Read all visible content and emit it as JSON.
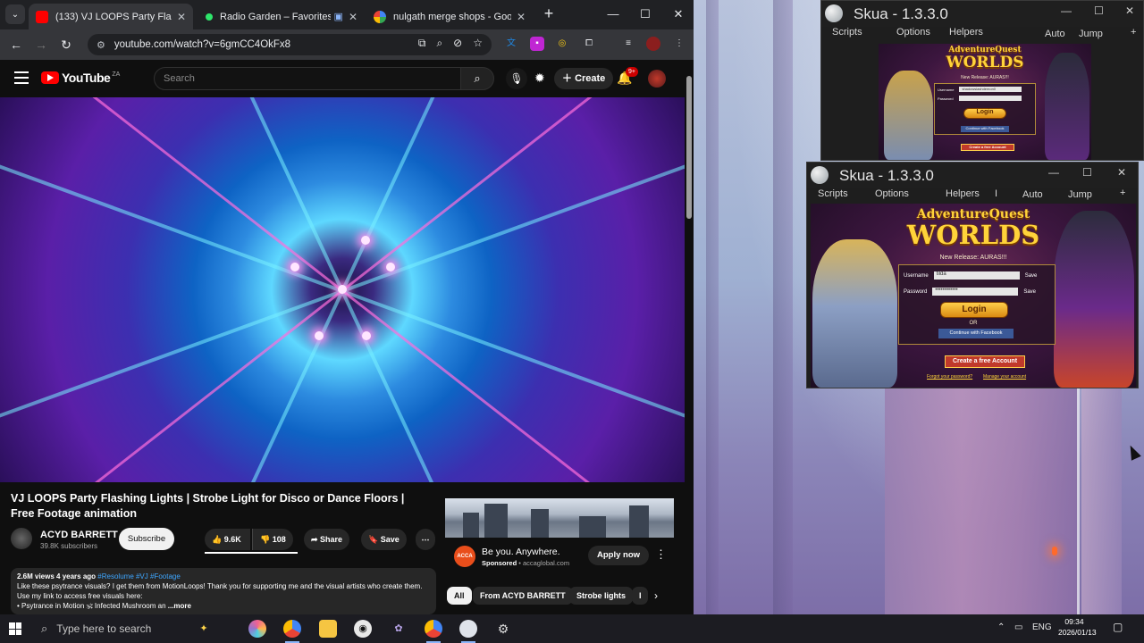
{
  "browser": {
    "tabs": [
      {
        "title": "(133) VJ LOOPS Party Flashing L",
        "favicon": "youtube-icon",
        "active": true
      },
      {
        "title": "Radio Garden – Favorites",
        "favicon": "radio-garden-icon",
        "active": false
      },
      {
        "title": "nulgath merge shops - Google",
        "favicon": "google-icon",
        "active": false
      }
    ],
    "url": "youtube.com/watch?v=6gmCC4OkFx8"
  },
  "youtube": {
    "logo_text": "YouTube",
    "logo_superscript": "ZA",
    "search_placeholder": "Search",
    "create_label": "Create",
    "notification_count": "9+",
    "video_title": "VJ LOOPS Party Flashing Lights | Strobe Light for Disco or Dance Floors | Free Footage animation",
    "channel": {
      "name": "ACYD BARRETT",
      "subscribers": "39.8K subscribers",
      "subscribe_label": "Subscribe"
    },
    "actions": {
      "likes": "9.6K",
      "dislikes": "108",
      "share": "Share",
      "save": "Save"
    },
    "description": {
      "meta": "2.6M views  4 years ago",
      "tags": "#Resolume #VJ #Footage",
      "text": "Like these psytrance visuals? I get them from MotionLoops! Thank you for supporting me and the visual artists who create them. Use my link to access free visuals here:",
      "link": "• Psytrance in Motion 🕉 Infected Mushroom an",
      "more": "...more"
    },
    "ad": {
      "logo_text": "ACCA",
      "title": "Be you. Anywhere.",
      "sponsored": "Sponsored",
      "domain": "accaglobal.com",
      "cta": "Apply now"
    },
    "chips": [
      "All",
      "From ACYD BARRETT",
      "Strobe lights",
      "I"
    ]
  },
  "skua_windows": [
    {
      "title": "Skua - 1.3.3.0",
      "menu": [
        "Scripts",
        "Options",
        "Helpers",
        "Auto",
        "Jump"
      ],
      "game": {
        "title_top": "AdventureQuest",
        "title_main": "WORLDS",
        "release": "New Release: AURAS!!!",
        "username": "Username",
        "password": "Password",
        "username_value": "shadowslashdemon0",
        "login": "Login",
        "or": "OR",
        "facebook": "Continue with Facebook",
        "save": "Save",
        "create": "Create a free Account"
      }
    },
    {
      "title": "Skua - 1.3.3.0",
      "menu": [
        "Scripts",
        "Options",
        "Helpers",
        "I",
        "Auto",
        "Jump"
      ],
      "game": {
        "title_top": "AdventureQuest",
        "title_main": "WORLDS",
        "release": "New Release: AURAS!!!",
        "username": "Username",
        "password": "Password",
        "username_value": "tilda",
        "password_value": "••••••••••••",
        "login": "Login",
        "or": "OR",
        "facebook": "Continue with Facebook",
        "save": "Save",
        "create": "Create a free Account",
        "forgot": "Forgot your password?",
        "manage": "Manage your account"
      }
    }
  ],
  "taskbar": {
    "search_placeholder": "Type here to search",
    "language": "ENG",
    "time": "09:34",
    "date": "2026/01/13"
  },
  "colors": {
    "youtube_red": "#ff0000",
    "chrome_bg": "#202124",
    "skua_bg": "#1e1e1e",
    "aqw_gold": "#ffd33a"
  }
}
